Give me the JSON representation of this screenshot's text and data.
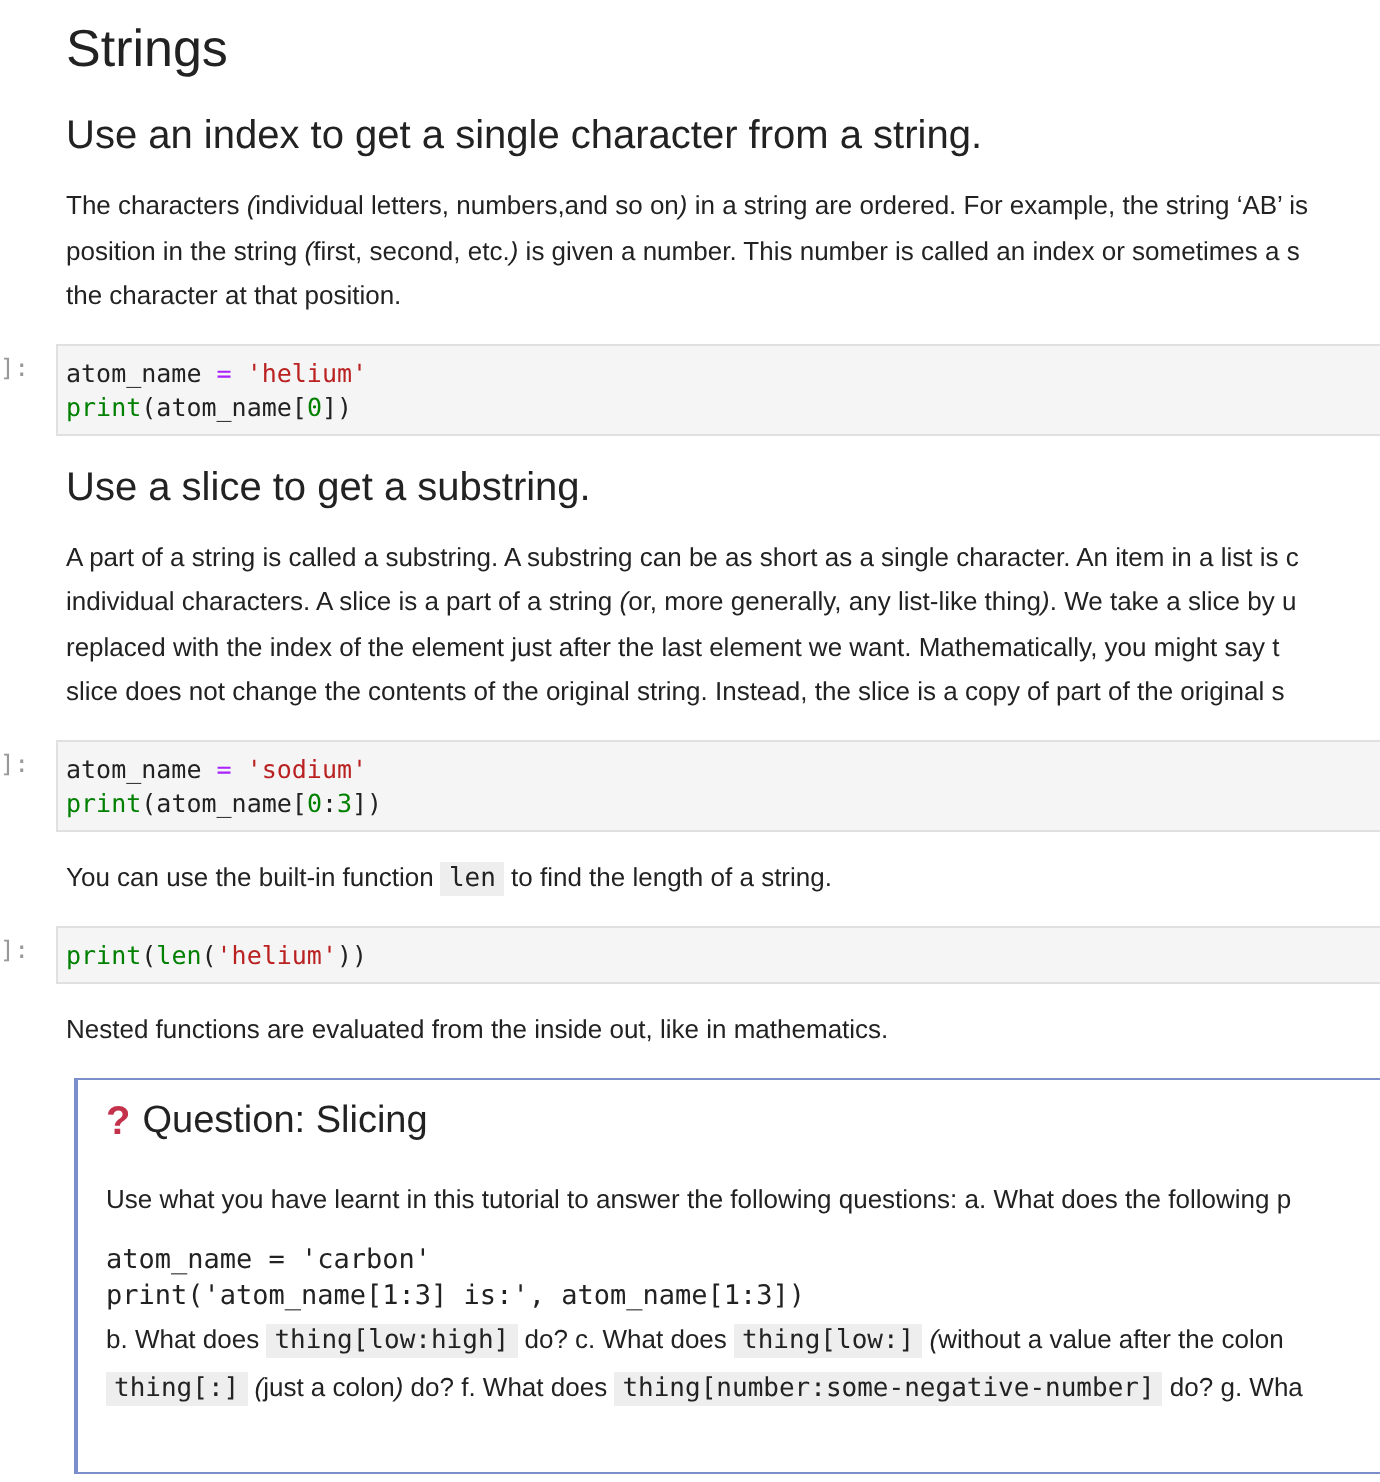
{
  "title": "Strings",
  "cells": [
    {
      "kind": "heading",
      "text": "Use an index to get a single character from a string."
    },
    {
      "kind": "paragraph",
      "lines": [
        [
          {
            "kind": "text",
            "text": "The characters "
          },
          {
            "kind": "em",
            "text": "("
          },
          {
            "kind": "text",
            "text": "individual letters, numbers,and so on"
          },
          {
            "kind": "em",
            "text": ")"
          },
          {
            "kind": "text",
            "text": " in a string are ordered. For example, the string ‘AB’ is"
          }
        ],
        [
          {
            "kind": "text",
            "text": "position in the string "
          },
          {
            "kind": "em",
            "text": "("
          },
          {
            "kind": "text",
            "text": "first, second, etc."
          },
          {
            "kind": "em",
            "text": ")"
          },
          {
            "kind": "text",
            "text": " is given a number. This number is called an index or sometimes a s"
          }
        ],
        [
          {
            "kind": "text",
            "text": "the character at that position."
          }
        ]
      ]
    },
    {
      "kind": "code",
      "prompt": "]:",
      "lines": [
        [
          {
            "kind": "name",
            "text": "atom_name "
          },
          {
            "kind": "op",
            "text": "= "
          },
          {
            "kind": "string",
            "text": "'helium'"
          }
        ],
        [
          {
            "kind": "builtin",
            "text": "print"
          },
          {
            "kind": "name",
            "text": "(atom_name["
          },
          {
            "kind": "number",
            "text": "0"
          },
          {
            "kind": "name",
            "text": "])"
          }
        ]
      ]
    },
    {
      "kind": "heading",
      "text": "Use a slice to get a substring."
    },
    {
      "kind": "paragraph",
      "lines": [
        [
          {
            "kind": "text",
            "text": "A part of a string is called a substring. A substring can be as short as a single character. An item in a list is c"
          }
        ],
        [
          {
            "kind": "text",
            "text": "individual characters. A slice is a part of a string "
          },
          {
            "kind": "em",
            "text": "("
          },
          {
            "kind": "text",
            "text": "or, more generally, any list-like thing"
          },
          {
            "kind": "em",
            "text": ")"
          },
          {
            "kind": "text",
            "text": ". We take a slice by u"
          }
        ],
        [
          {
            "kind": "text",
            "text": "replaced with the index of the element just after the last element we want. Mathematically, you might say t"
          }
        ],
        [
          {
            "kind": "text",
            "text": "slice does not change the contents of the original string. Instead, the slice is a copy of part of the original s"
          }
        ]
      ]
    },
    {
      "kind": "code",
      "prompt": "]:",
      "lines": [
        [
          {
            "kind": "name",
            "text": "atom_name "
          },
          {
            "kind": "op",
            "text": "= "
          },
          {
            "kind": "string",
            "text": "'sodium'"
          }
        ],
        [
          {
            "kind": "builtin",
            "text": "print"
          },
          {
            "kind": "name",
            "text": "(atom_name["
          },
          {
            "kind": "number",
            "text": "0"
          },
          {
            "kind": "name",
            "text": ":"
          },
          {
            "kind": "number",
            "text": "3"
          },
          {
            "kind": "name",
            "text": "])"
          }
        ]
      ]
    },
    {
      "kind": "paragraph",
      "lines": [
        [
          {
            "kind": "text",
            "text": "You can use the built-in function "
          },
          {
            "kind": "code",
            "text": "len"
          },
          {
            "kind": "text",
            "text": " to find the length of a string."
          }
        ]
      ]
    },
    {
      "kind": "code",
      "prompt": "]:",
      "lines": [
        [
          {
            "kind": "builtin",
            "text": "print"
          },
          {
            "kind": "name",
            "text": "("
          },
          {
            "kind": "builtin",
            "text": "len"
          },
          {
            "kind": "name",
            "text": "("
          },
          {
            "kind": "string",
            "text": "'helium'"
          },
          {
            "kind": "name",
            "text": "))"
          }
        ]
      ]
    },
    {
      "kind": "paragraph",
      "lines": [
        [
          {
            "kind": "text",
            "text": "Nested functions are evaluated from the inside out, like in mathematics."
          }
        ]
      ]
    },
    {
      "kind": "question",
      "icon": "?",
      "title": "Question: Slicing",
      "body": [
        {
          "kind": "paragraph",
          "lines": [
            [
              {
                "kind": "text",
                "text": "Use what you have learnt in this tutorial to answer the following questions: a. What does the following p"
              }
            ]
          ]
        },
        {
          "kind": "plaincode",
          "lines": [
            "atom_name = 'carbon'",
            "print('atom_name[1:3] is:', atom_name[1:3])"
          ]
        },
        {
          "kind": "paragraph",
          "lines": [
            [
              {
                "kind": "text",
                "text": "b. What does "
              },
              {
                "kind": "code",
                "text": "thing[low:high]"
              },
              {
                "kind": "text",
                "text": " do? c. What does "
              },
              {
                "kind": "code",
                "text": "thing[low:]"
              },
              {
                "kind": "em",
                "text": " ("
              },
              {
                "kind": "text",
                "text": "without a value after the colon"
              }
            ],
            [
              {
                "kind": "code",
                "text": "thing[:]"
              },
              {
                "kind": "em",
                "text": " ("
              },
              {
                "kind": "text",
                "text": "just a colon"
              },
              {
                "kind": "em",
                "text": ")"
              },
              {
                "kind": "text",
                "text": " do? f. What does "
              },
              {
                "kind": "code",
                "text": "thing[number:some-negative-number]"
              },
              {
                "kind": "text",
                "text": " do? g. Wha"
              }
            ]
          ]
        }
      ]
    }
  ]
}
